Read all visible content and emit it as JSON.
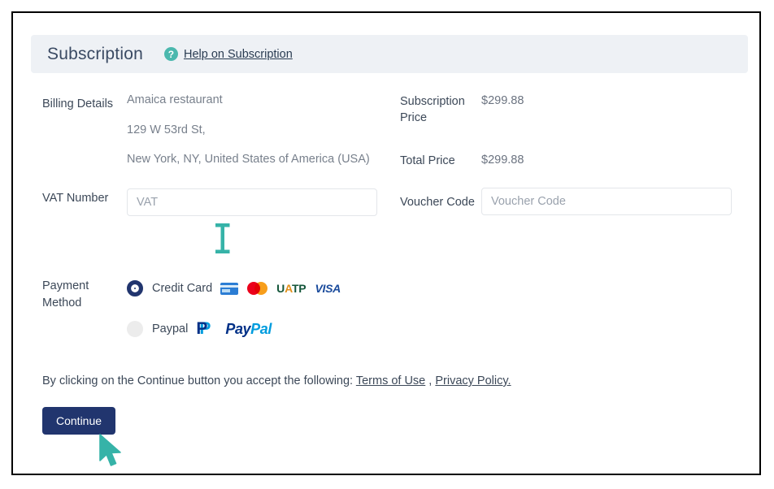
{
  "colors": {
    "header_band": "#eef1f5",
    "help_icon": "#4bb8ae",
    "primary_button": "#21356e",
    "cursor_teal": "#36b3a8",
    "label_text": "#3c4858",
    "value_text": "#78808c"
  },
  "header": {
    "title": "Subscription",
    "help_icon_name": "question-mark-icon",
    "help_link": "Help on Subscription"
  },
  "billing": {
    "label": "Billing Details",
    "lines": [
      "Amaica restaurant",
      "129 W 53rd St,",
      "New York, NY, United States of America (USA)"
    ]
  },
  "vat": {
    "label": "VAT Number",
    "value": "",
    "placeholder": "VAT"
  },
  "prices": {
    "subscription_label": "Subscription Price",
    "subscription_value": "$299.88",
    "total_label": "Total Price",
    "total_value": "$299.88"
  },
  "voucher": {
    "label": "Voucher Code",
    "value": "",
    "placeholder": "Voucher Code"
  },
  "payment": {
    "label": "Payment Method",
    "options": [
      {
        "id": "credit-card",
        "label": "Credit Card",
        "selected": true,
        "logos": [
          "amex-card-icon",
          "mastercard-icon",
          "uatp-icon",
          "visa-icon"
        ],
        "uatp_text": "UATP",
        "visa_text": "VISA"
      },
      {
        "id": "paypal",
        "label": "Paypal",
        "selected": false,
        "logos": [
          "paypal-icon"
        ],
        "paypal_pay": "Pay",
        "paypal_pal": "Pal"
      }
    ]
  },
  "terms": {
    "prefix": "By clicking on the Continue button you accept the following: ",
    "terms_link": "Terms of Use",
    "separator": " , ",
    "privacy_link": "Privacy Policy."
  },
  "actions": {
    "continue_label": "Continue"
  },
  "cursors": {
    "text_cursor_name": "text-ibeam-cursor",
    "mouse_cursor_name": "mouse-pointer-cursor"
  }
}
